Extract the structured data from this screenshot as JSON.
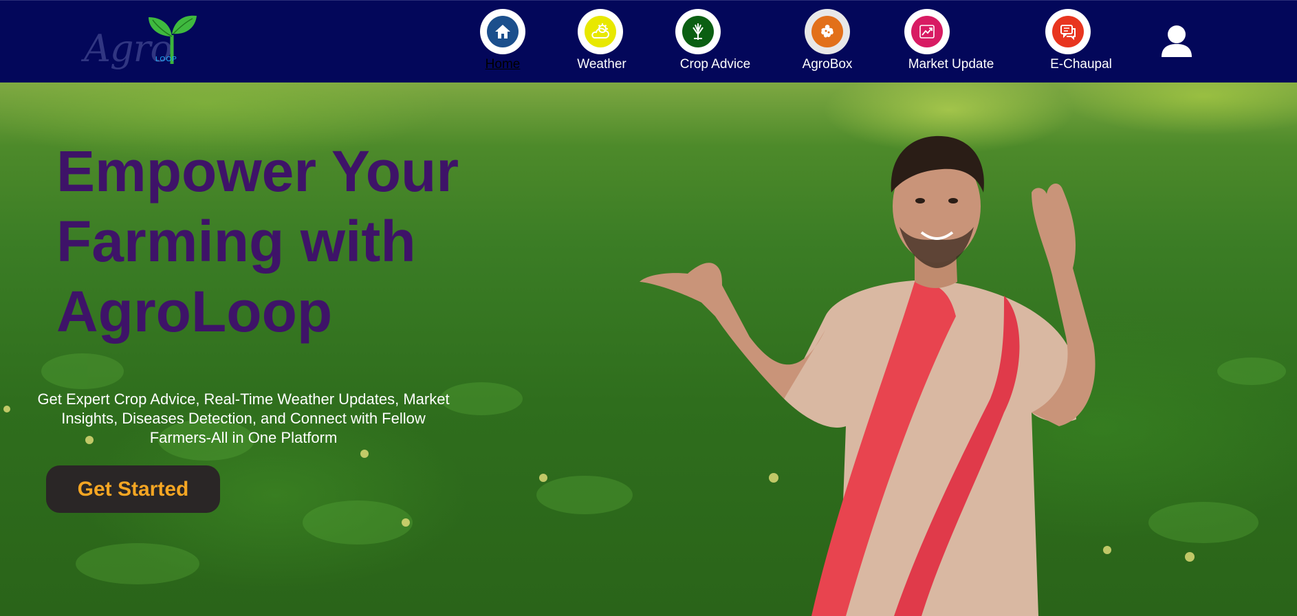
{
  "logo": {
    "text": "Agro",
    "subtext": "LOOP"
  },
  "nav": {
    "items": [
      {
        "label": "Home",
        "icon": "home-icon",
        "color": "#1b4f8c",
        "active": true
      },
      {
        "label": "Weather",
        "icon": "weather-icon",
        "color": "#e8e800"
      },
      {
        "label": "Crop Advice",
        "icon": "crop-icon",
        "color": "#0b5f12"
      },
      {
        "label": "AgroBox",
        "icon": "box-icon",
        "color": "#e2701a"
      },
      {
        "label": "Market Update",
        "icon": "market-icon",
        "color": "#d81b63"
      },
      {
        "label": "E-Chaupal",
        "icon": "chat-icon",
        "color": "#e8351f"
      }
    ]
  },
  "hero": {
    "headline": [
      "Empower Your",
      "Farming with",
      "AgroLoop"
    ],
    "subtext": "Get Expert Crop Advice, Real-Time Weather Updates, Market Insights, Diseases Detection, and Connect with Fellow Farmers-All in One Platform",
    "cta_label": "Get Started"
  },
  "colors": {
    "navbar": "#03075a",
    "headline": "#3e1368",
    "cta_bg": "#2a2626",
    "cta_text": "#f5a623"
  }
}
